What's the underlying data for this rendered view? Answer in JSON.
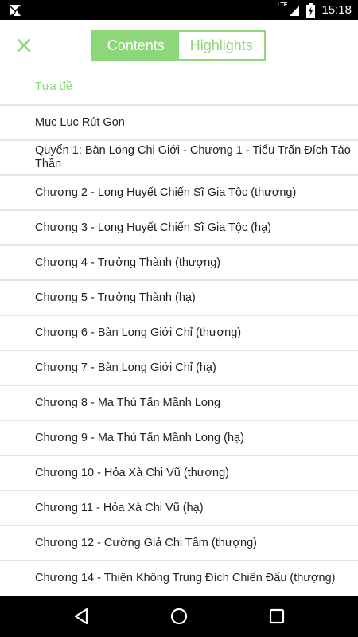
{
  "status_bar": {
    "time": "15:18",
    "network": "LTE"
  },
  "toolbar": {
    "tab_contents": "Contents",
    "tab_highlights": "Highlights"
  },
  "toc": {
    "title": "Tựa đề",
    "items": [
      "Mục Lục Rút Gọn",
      "Quyển 1: Bàn Long Chi Giới - Chương 1 - Tiểu Trấn Đích Tào Thần",
      "Chương 2 - Long Huyết Chiến Sĩ Gia Tộc (thượng)",
      "Chương 3 - Long Huyết Chiến Sĩ Gia Tộc (hạ)",
      "Chương 4 - Trưởng Thành (thượng)",
      "Chương 5 - Trưởng Thành (hạ)",
      "Chương 6 - Bàn Long Giới Chỉ (thượng)",
      "Chương 7 - Bàn Long Giới Chỉ (hạ)",
      "Chương 8 - Ma Thú Tấn Mãnh Long",
      "Chương 9 - Ma Thú Tấn Mãnh Long (hạ)",
      "Chương 10 - Hỏa Xà Chi Vũ (thượng)",
      "Chương 11 - Hỏa Xà Chi Vũ (hạ)",
      "Chương 12 - Cường Giả Chi Tâm (thượng)",
      "Chương 14 - Thiên Không Trung Đích Chiến Đấu (thượng)"
    ]
  },
  "colors": {
    "accent": "#8dd679",
    "divider": "#e5e5e5",
    "text": "#222222"
  },
  "icons": {
    "close": "close-icon",
    "back": "back-icon",
    "home": "home-icon",
    "recents": "recents-icon"
  }
}
